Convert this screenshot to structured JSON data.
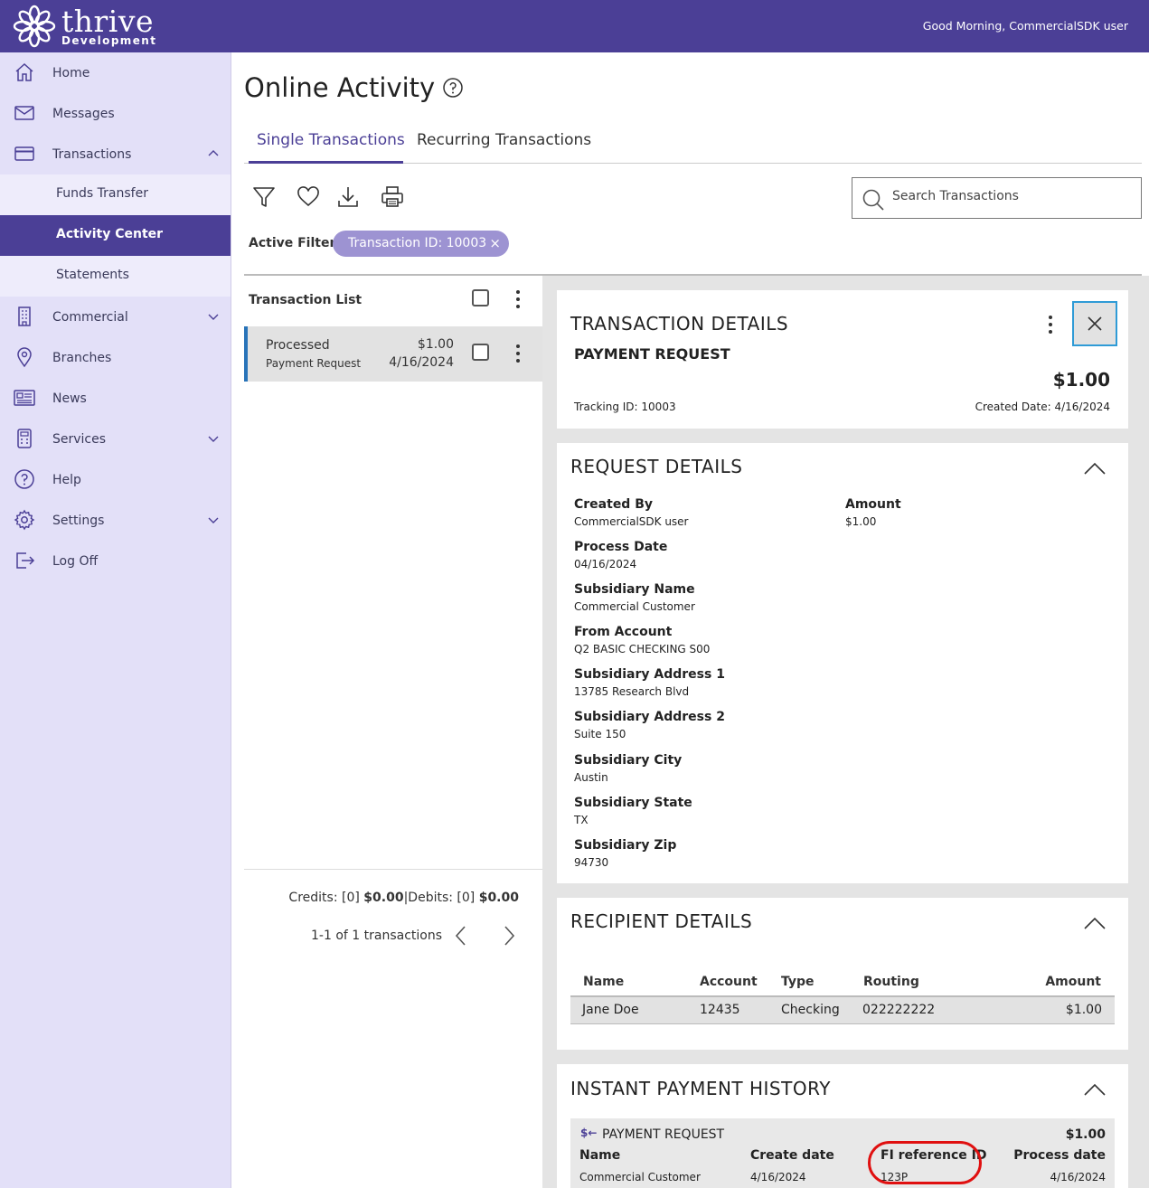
{
  "header": {
    "brand_name": "thrive",
    "brand_sub": "Development",
    "greeting": "Good Morning, CommercialSDK user"
  },
  "sidebar": {
    "items": [
      {
        "label": "Home",
        "icon": "home-icon"
      },
      {
        "label": "Messages",
        "icon": "mail-icon"
      },
      {
        "label": "Transactions",
        "icon": "card-icon",
        "expanded": true
      },
      {
        "label": "Commercial",
        "icon": "building-icon"
      },
      {
        "label": "Branches",
        "icon": "location-pin-icon"
      },
      {
        "label": "News",
        "icon": "newspaper-icon"
      },
      {
        "label": "Services",
        "icon": "calculator-icon"
      },
      {
        "label": "Help",
        "icon": "help-circle-icon"
      },
      {
        "label": "Settings",
        "icon": "gear-icon"
      },
      {
        "label": "Log Off",
        "icon": "logout-icon"
      }
    ],
    "sub_items": [
      {
        "label": "Funds Transfer"
      },
      {
        "label": "Activity Center",
        "active": true
      },
      {
        "label": "Statements"
      }
    ]
  },
  "page": {
    "title": "Online Activity",
    "tabs": [
      {
        "label": "Single Transactions",
        "active": true
      },
      {
        "label": "Recurring Transactions"
      }
    ],
    "search_placeholder": "Search Transactions",
    "active_filters_label": "Active Filters",
    "filter_chip": "Transaction ID: 10003",
    "filter_chip_close": "×"
  },
  "transaction_list": {
    "header": "Transaction List",
    "rows": [
      {
        "status": "Processed",
        "type": "Payment Request",
        "amount": "$1.00",
        "date": "4/16/2024"
      }
    ],
    "totals": {
      "credits_label": "Credits: [0]",
      "credits_value": "$0.00",
      "separator": "|",
      "debits_label": "Debits: [0]",
      "debits_value": "$0.00"
    },
    "pager": "1-1 of 1 transactions"
  },
  "transaction_details": {
    "title": "TRANSACTION DETAILS",
    "subtitle": "PAYMENT REQUEST",
    "amount": "$1.00",
    "tracking": "Tracking ID: 10003",
    "created": "Created Date: 4/16/2024"
  },
  "request_details": {
    "title": "REQUEST DETAILS",
    "fields_left": [
      {
        "label": "Created By",
        "value": "CommercialSDK user"
      },
      {
        "label": "Process Date",
        "value": "04/16/2024"
      },
      {
        "label": "Subsidiary Name",
        "value": "Commercial Customer"
      },
      {
        "label": "From Account",
        "value": "Q2 BASIC CHECKING S00"
      },
      {
        "label": "Subsidiary Address 1",
        "value": "13785 Research Blvd"
      },
      {
        "label": "Subsidiary Address 2",
        "value": "Suite 150"
      },
      {
        "label": "Subsidiary City",
        "value": "Austin"
      },
      {
        "label": "Subsidiary State",
        "value": "TX"
      },
      {
        "label": "Subsidiary Zip",
        "value": "94730"
      }
    ],
    "fields_right": [
      {
        "label": "Amount",
        "value": "$1.00"
      }
    ]
  },
  "recipient_details": {
    "title": "RECIPIENT DETAILS",
    "columns": [
      "Name",
      "Account",
      "Type",
      "Routing",
      "Amount"
    ],
    "rows": [
      {
        "name": "Jane Doe",
        "account": "12435",
        "type": "Checking",
        "routing": "022222222",
        "amount": "$1.00"
      }
    ]
  },
  "instant_payment_history": {
    "title": "INSTANT PAYMENT HISTORY",
    "item_icon_text": "$←",
    "item_type": "PAYMENT REQUEST",
    "item_amount": "$1.00",
    "columns": [
      "Name",
      "Create date",
      "FI reference ID",
      "Process date"
    ],
    "values": [
      "Commercial Customer",
      "4/16/2024",
      "123P",
      "4/16/2024"
    ]
  },
  "colors": {
    "brand": "#4b3f96",
    "sidebar_bg": "#e3e0f8",
    "chip": "#9d93d2",
    "highlight_circle": "#e01010",
    "row_accent": "#2873b8"
  }
}
